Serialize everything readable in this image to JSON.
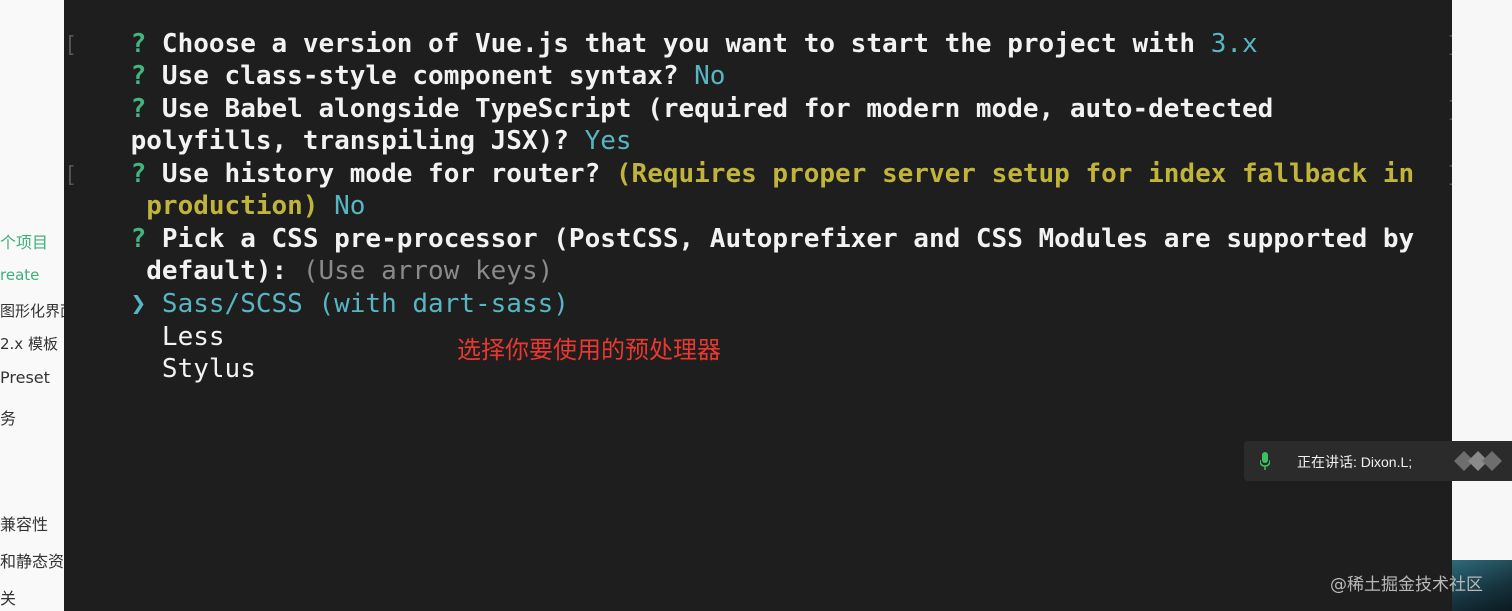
{
  "sidebar": {
    "items": [
      {
        "label": "个项目",
        "active": true
      },
      {
        "label": "reate",
        "active": true
      },
      {
        "label": "图形化界面"
      },
      {
        "label": "2.x 模板"
      },
      {
        "label": " Preset"
      },
      {
        "label": "务"
      },
      {
        "label": "兼容性"
      },
      {
        "label": "和静态资"
      },
      {
        "label": "关"
      }
    ]
  },
  "terminal": {
    "lines": {
      "l1": {
        "q": "?",
        "text": " Choose a version of Vue.js that you want to start the project with ",
        "answer": "3.x"
      },
      "l2": {
        "q": "?",
        "text": " Use class-style component syntax? ",
        "answer": "No"
      },
      "l3": {
        "q": "?",
        "text": " Use Babel alongside TypeScript (required for modern mode, auto-detected"
      },
      "l4": {
        "text": "polyfills, transpiling JSX)? ",
        "answer": "Yes"
      },
      "l5": {
        "q": "?",
        "text": " Use history mode for router? ",
        "hint": "(Requires proper server setup for index fallback in"
      },
      "l6": {
        "hint": " production)",
        "answer": " No"
      },
      "l7": {
        "q": "?",
        "text": " Pick a CSS pre-processor (PostCSS, Autoprefixer and CSS Modules are supported by"
      },
      "l8": {
        "text": " default): ",
        "hint": "(Use arrow keys)"
      },
      "l9": {
        "pointer": "❯",
        "option": " Sass/SCSS (with dart-sass)"
      },
      "l10": {
        "option": "  Less"
      },
      "l11": {
        "option": "  Stylus"
      }
    },
    "annotation": "选择你要使用的预处理器"
  },
  "toast": {
    "text": "正在讲话: Dixon.L;",
    "icon": "microphone-icon"
  },
  "watermark": "@稀土掘金技术社区",
  "colors": {
    "terminal_bg": "#1e1e1e",
    "question_mark": "#43b581",
    "answer": "#56b6c2",
    "hint": "#c0b43b",
    "annotation": "#e8382f",
    "sidebar_active": "#3eaf7c"
  }
}
